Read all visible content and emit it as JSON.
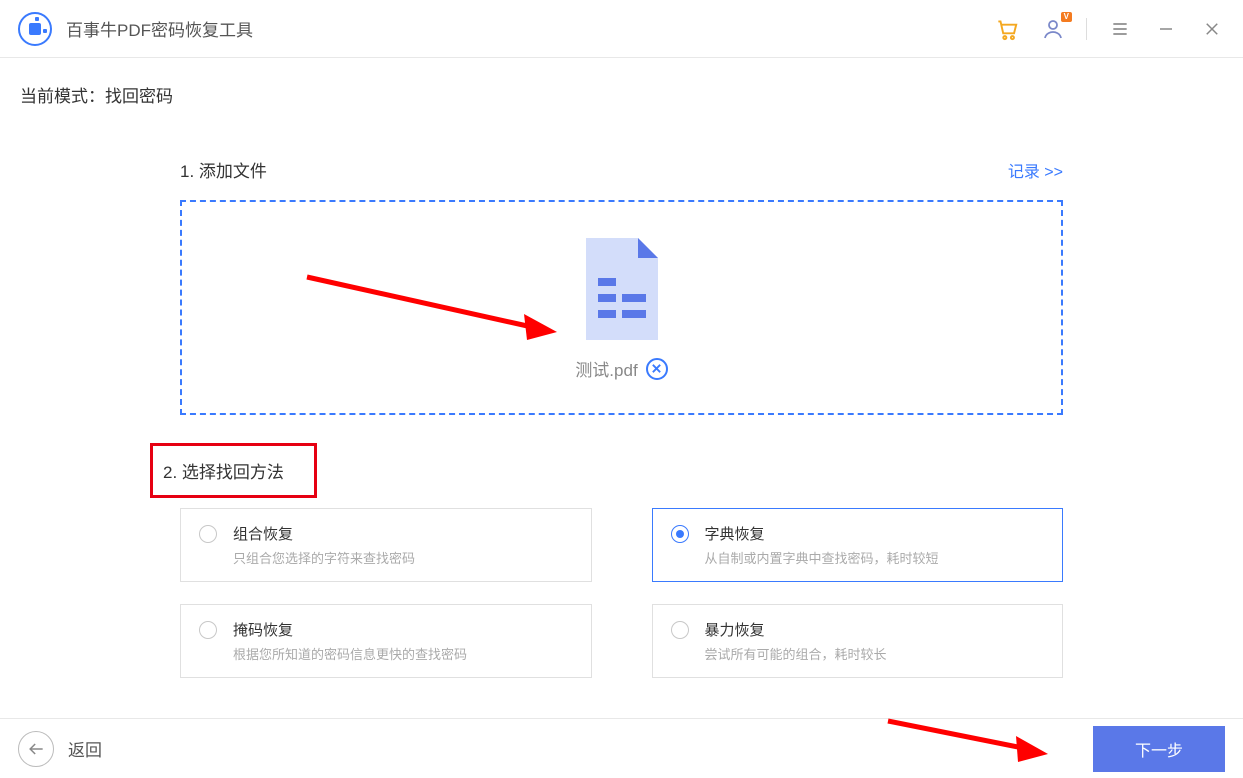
{
  "app_title": "百事牛PDF密码恢复工具",
  "vip_badge": "V",
  "mode_label": "当前模式：",
  "mode_value": "找回密码",
  "step1_title": "1. 添加文件",
  "history_link": "记录 >>",
  "file_name": "测试.pdf",
  "step2_title": "2. 选择找回方法",
  "options": [
    {
      "name": "组合恢复",
      "desc": "只组合您选择的字符来查找密码",
      "selected": false
    },
    {
      "name": "字典恢复",
      "desc": "从自制或内置字典中查找密码，耗时较短",
      "selected": true
    },
    {
      "name": "掩码恢复",
      "desc": "根据您所知道的密码信息更快的查找密码",
      "selected": false
    },
    {
      "name": "暴力恢复",
      "desc": "尝试所有可能的组合，耗时较长",
      "selected": false
    }
  ],
  "back_label": "返回",
  "next_label": "下一步"
}
